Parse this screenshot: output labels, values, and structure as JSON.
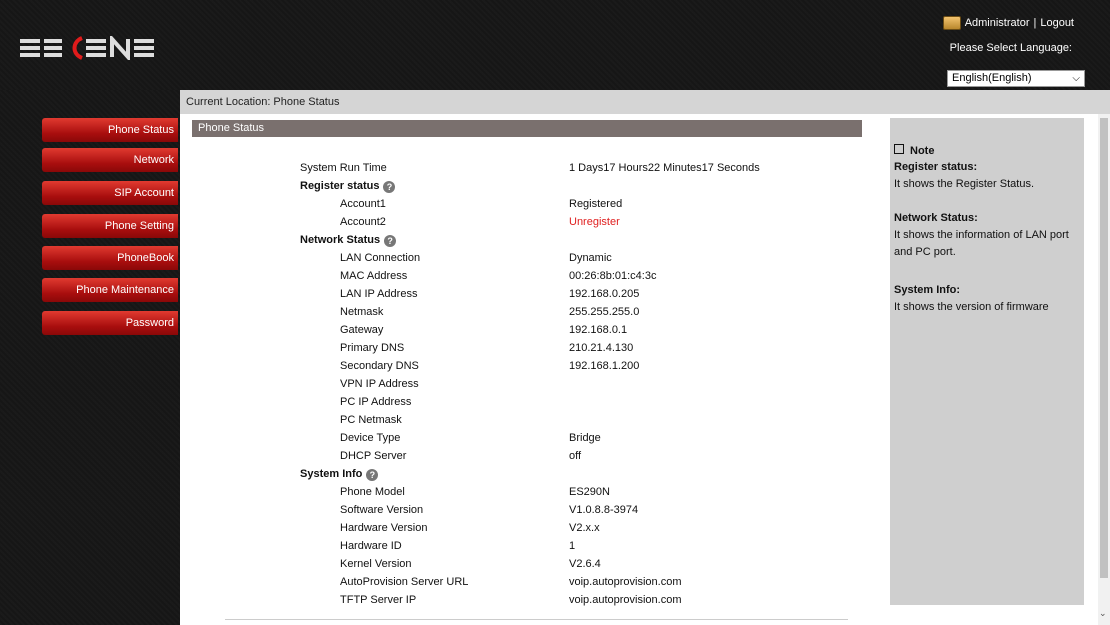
{
  "header": {
    "logo": "ESCENE",
    "user": "Administrator",
    "separator": "|",
    "logout": "Logout",
    "language_label": "Please Select Language:",
    "language_value": "English(English)"
  },
  "location": "Current Location: Phone Status",
  "sidebar": {
    "items": [
      {
        "label": "Phone Status"
      },
      {
        "label": "Network"
      },
      {
        "label": "SIP Account"
      },
      {
        "label": "Phone Setting"
      },
      {
        "label": "PhoneBook"
      },
      {
        "label": "Phone Maintenance"
      },
      {
        "label": "Password"
      }
    ]
  },
  "panel": {
    "title": "Phone Status",
    "system_run_time": {
      "label": "System Run Time",
      "value": "1 Days17 Hours22 Minutes17 Seconds"
    },
    "register": {
      "title": "Register status",
      "rows": [
        {
          "label": "Account1",
          "value": "Registered"
        },
        {
          "label": "Account2",
          "value": "Unregister"
        }
      ]
    },
    "network": {
      "title": "Network Status",
      "rows": [
        {
          "label": "LAN Connection",
          "value": "Dynamic"
        },
        {
          "label": "MAC Address",
          "value": "00:26:8b:01:c4:3c"
        },
        {
          "label": "LAN IP Address",
          "value": "192.168.0.205"
        },
        {
          "label": "Netmask",
          "value": "255.255.255.0"
        },
        {
          "label": "Gateway",
          "value": "192.168.0.1"
        },
        {
          "label": "Primary DNS",
          "value": "210.21.4.130"
        },
        {
          "label": "Secondary DNS",
          "value": "192.168.1.200"
        },
        {
          "label": "VPN IP Address",
          "value": ""
        },
        {
          "label": "PC IP Address",
          "value": ""
        },
        {
          "label": "PC Netmask",
          "value": ""
        },
        {
          "label": "Device Type",
          "value": "Bridge"
        },
        {
          "label": "DHCP Server",
          "value": "off"
        }
      ]
    },
    "system": {
      "title": "System Info",
      "rows": [
        {
          "label": "Phone Model",
          "value": "ES290N"
        },
        {
          "label": "Software Version",
          "value": "V1.0.8.8-3974"
        },
        {
          "label": "Hardware Version",
          "value": "V2.x.x"
        },
        {
          "label": "Hardware ID",
          "value": "1"
        },
        {
          "label": "Kernel Version",
          "value": "V2.6.4"
        },
        {
          "label": "AutoProvision Server URL",
          "value": "voip.autoprovision.com"
        },
        {
          "label": "TFTP Server IP",
          "value": "voip.autoprovision.com"
        }
      ]
    }
  },
  "note": {
    "title": "Note",
    "register_heading": "Register status:",
    "register_text": "It shows the Register Status.",
    "network_heading": "Network Status:",
    "network_text": "It shows the information of LAN port and PC port.",
    "system_heading": "System Info:",
    "system_text": "It shows the version of firmware"
  },
  "colors": {
    "accent_red": "#c41515",
    "unregister_red": "#e02020",
    "panel_header": "#7a706e"
  },
  "icons": {
    "help": "help-circle-icon",
    "user": "user-icon",
    "note": "note-square-icon"
  }
}
